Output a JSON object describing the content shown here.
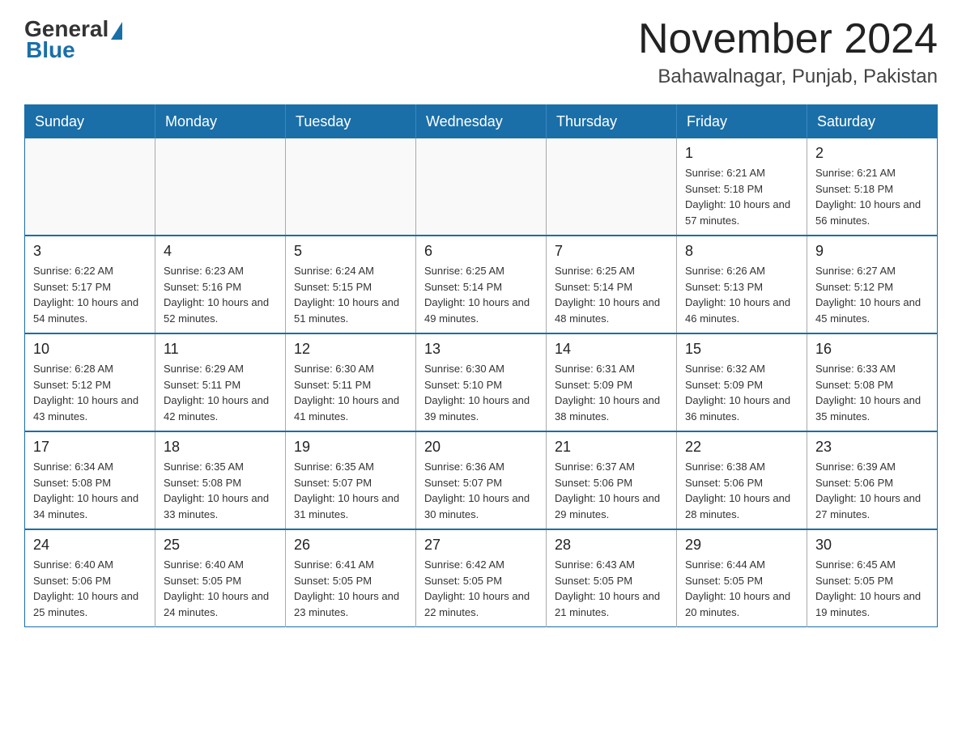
{
  "logo": {
    "general": "General",
    "blue": "Blue"
  },
  "title": {
    "month": "November 2024",
    "location": "Bahawalnagar, Punjab, Pakistan"
  },
  "weekdays": [
    "Sunday",
    "Monday",
    "Tuesday",
    "Wednesday",
    "Thursday",
    "Friday",
    "Saturday"
  ],
  "weeks": [
    [
      {
        "day": "",
        "info": ""
      },
      {
        "day": "",
        "info": ""
      },
      {
        "day": "",
        "info": ""
      },
      {
        "day": "",
        "info": ""
      },
      {
        "day": "",
        "info": ""
      },
      {
        "day": "1",
        "info": "Sunrise: 6:21 AM\nSunset: 5:18 PM\nDaylight: 10 hours and 57 minutes."
      },
      {
        "day": "2",
        "info": "Sunrise: 6:21 AM\nSunset: 5:18 PM\nDaylight: 10 hours and 56 minutes."
      }
    ],
    [
      {
        "day": "3",
        "info": "Sunrise: 6:22 AM\nSunset: 5:17 PM\nDaylight: 10 hours and 54 minutes."
      },
      {
        "day": "4",
        "info": "Sunrise: 6:23 AM\nSunset: 5:16 PM\nDaylight: 10 hours and 52 minutes."
      },
      {
        "day": "5",
        "info": "Sunrise: 6:24 AM\nSunset: 5:15 PM\nDaylight: 10 hours and 51 minutes."
      },
      {
        "day": "6",
        "info": "Sunrise: 6:25 AM\nSunset: 5:14 PM\nDaylight: 10 hours and 49 minutes."
      },
      {
        "day": "7",
        "info": "Sunrise: 6:25 AM\nSunset: 5:14 PM\nDaylight: 10 hours and 48 minutes."
      },
      {
        "day": "8",
        "info": "Sunrise: 6:26 AM\nSunset: 5:13 PM\nDaylight: 10 hours and 46 minutes."
      },
      {
        "day": "9",
        "info": "Sunrise: 6:27 AM\nSunset: 5:12 PM\nDaylight: 10 hours and 45 minutes."
      }
    ],
    [
      {
        "day": "10",
        "info": "Sunrise: 6:28 AM\nSunset: 5:12 PM\nDaylight: 10 hours and 43 minutes."
      },
      {
        "day": "11",
        "info": "Sunrise: 6:29 AM\nSunset: 5:11 PM\nDaylight: 10 hours and 42 minutes."
      },
      {
        "day": "12",
        "info": "Sunrise: 6:30 AM\nSunset: 5:11 PM\nDaylight: 10 hours and 41 minutes."
      },
      {
        "day": "13",
        "info": "Sunrise: 6:30 AM\nSunset: 5:10 PM\nDaylight: 10 hours and 39 minutes."
      },
      {
        "day": "14",
        "info": "Sunrise: 6:31 AM\nSunset: 5:09 PM\nDaylight: 10 hours and 38 minutes."
      },
      {
        "day": "15",
        "info": "Sunrise: 6:32 AM\nSunset: 5:09 PM\nDaylight: 10 hours and 36 minutes."
      },
      {
        "day": "16",
        "info": "Sunrise: 6:33 AM\nSunset: 5:08 PM\nDaylight: 10 hours and 35 minutes."
      }
    ],
    [
      {
        "day": "17",
        "info": "Sunrise: 6:34 AM\nSunset: 5:08 PM\nDaylight: 10 hours and 34 minutes."
      },
      {
        "day": "18",
        "info": "Sunrise: 6:35 AM\nSunset: 5:08 PM\nDaylight: 10 hours and 33 minutes."
      },
      {
        "day": "19",
        "info": "Sunrise: 6:35 AM\nSunset: 5:07 PM\nDaylight: 10 hours and 31 minutes."
      },
      {
        "day": "20",
        "info": "Sunrise: 6:36 AM\nSunset: 5:07 PM\nDaylight: 10 hours and 30 minutes."
      },
      {
        "day": "21",
        "info": "Sunrise: 6:37 AM\nSunset: 5:06 PM\nDaylight: 10 hours and 29 minutes."
      },
      {
        "day": "22",
        "info": "Sunrise: 6:38 AM\nSunset: 5:06 PM\nDaylight: 10 hours and 28 minutes."
      },
      {
        "day": "23",
        "info": "Sunrise: 6:39 AM\nSunset: 5:06 PM\nDaylight: 10 hours and 27 minutes."
      }
    ],
    [
      {
        "day": "24",
        "info": "Sunrise: 6:40 AM\nSunset: 5:06 PM\nDaylight: 10 hours and 25 minutes."
      },
      {
        "day": "25",
        "info": "Sunrise: 6:40 AM\nSunset: 5:05 PM\nDaylight: 10 hours and 24 minutes."
      },
      {
        "day": "26",
        "info": "Sunrise: 6:41 AM\nSunset: 5:05 PM\nDaylight: 10 hours and 23 minutes."
      },
      {
        "day": "27",
        "info": "Sunrise: 6:42 AM\nSunset: 5:05 PM\nDaylight: 10 hours and 22 minutes."
      },
      {
        "day": "28",
        "info": "Sunrise: 6:43 AM\nSunset: 5:05 PM\nDaylight: 10 hours and 21 minutes."
      },
      {
        "day": "29",
        "info": "Sunrise: 6:44 AM\nSunset: 5:05 PM\nDaylight: 10 hours and 20 minutes."
      },
      {
        "day": "30",
        "info": "Sunrise: 6:45 AM\nSunset: 5:05 PM\nDaylight: 10 hours and 19 minutes."
      }
    ]
  ]
}
